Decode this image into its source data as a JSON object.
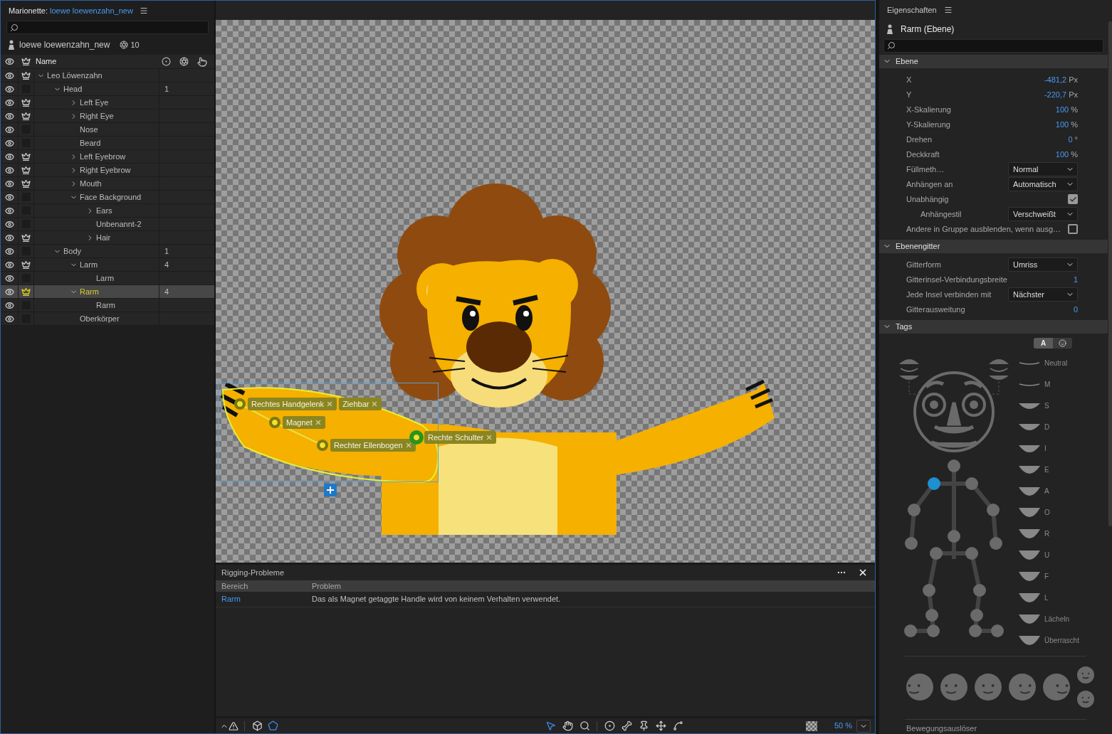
{
  "puppet": {
    "title_label": "Marionette:",
    "title_link": "loewe loewenzahn_new",
    "name": "loewe loewenzahn_new",
    "count": "10",
    "column_name": "Name",
    "layers": [
      {
        "name": "Leo Löwenzahn",
        "crown": true,
        "selected": false,
        "expanded": true,
        "children": [
          {
            "name": "Head",
            "crown": false,
            "selected": false,
            "expanded": true,
            "count": "1",
            "children": [
              {
                "name": "Left Eye",
                "crown": true,
                "selected": false,
                "expanded": false
              },
              {
                "name": "Right Eye",
                "crown": true,
                "selected": false,
                "expanded": false
              },
              {
                "name": "Nose",
                "crown": false,
                "selected": false
              },
              {
                "name": "Beard",
                "crown": false,
                "selected": false
              },
              {
                "name": "Left Eyebrow",
                "crown": true,
                "selected": false,
                "expanded": false
              },
              {
                "name": "Right Eyebrow",
                "crown": true,
                "selected": false,
                "expanded": false
              },
              {
                "name": "Mouth",
                "crown": true,
                "selected": false,
                "expanded": false
              },
              {
                "name": "Face Background",
                "crown": false,
                "selected": false,
                "expanded": true,
                "children": [
                  {
                    "name": "Ears",
                    "crown": false,
                    "selected": false,
                    "expanded": false
                  },
                  {
                    "name": "Unbenannt-2",
                    "crown": false,
                    "selected": false
                  },
                  {
                    "name": "Hair",
                    "crown": true,
                    "selected": false,
                    "expanded": false
                  }
                ]
              }
            ]
          },
          {
            "name": "Body",
            "crown": false,
            "selected": false,
            "expanded": true,
            "count": "1",
            "children": [
              {
                "name": "Larm",
                "crown": true,
                "selected": false,
                "expanded": true,
                "count": "4",
                "children": [
                  {
                    "name": "Larm",
                    "crown": false,
                    "selected": false
                  }
                ]
              },
              {
                "name": "Rarm",
                "crown": true,
                "selected": true,
                "expanded": true,
                "count": "4",
                "children": [
                  {
                    "name": "Rarm",
                    "crown": false,
                    "selected": false
                  }
                ]
              },
              {
                "name": "Oberkörper",
                "crown": false,
                "selected": false
              }
            ]
          }
        ]
      }
    ]
  },
  "canvas": {
    "handles": [
      {
        "tags": [
          "Rechtes Handgelenk",
          "Ziehbar"
        ],
        "selected": false
      },
      {
        "tags": [
          "Magnet"
        ],
        "selected": false
      },
      {
        "tags": [
          "Rechter Ellenbogen"
        ],
        "selected": false
      },
      {
        "tags": [
          "Rechte Schulter"
        ],
        "selected": true
      }
    ]
  },
  "problems": {
    "title": "Rigging-Probleme",
    "columns": [
      "Bereich",
      "Problem"
    ],
    "rows": [
      {
        "area": "Rarm",
        "problem": "Das als Magnet getaggte Handle wird von keinem Verhalten verwendet."
      }
    ]
  },
  "toolbar": {
    "left_tools": [
      {
        "kind": "mesh",
        "selected": false
      },
      {
        "kind": "polygon",
        "selected": true
      }
    ],
    "tools": [
      {
        "kind": "arrow",
        "selected": true
      },
      {
        "kind": "hand",
        "selected": false
      },
      {
        "kind": "zoom",
        "selected": false
      },
      {
        "kind": "handle",
        "selected": false
      },
      {
        "kind": "stick",
        "selected": false
      },
      {
        "kind": "pin",
        "selected": false
      },
      {
        "kind": "dragger",
        "selected": false
      },
      {
        "kind": "bend",
        "selected": false
      }
    ],
    "zoom": "50 %"
  },
  "properties": {
    "title": "Eigenschaften",
    "layer": "Rarm (Ebene)",
    "sections": [
      {
        "title": "Ebene",
        "expanded": true,
        "rows": [
          {
            "kind": "value",
            "label": "X",
            "value": "-481,2",
            "unit": "Px"
          },
          {
            "kind": "value",
            "label": "Y",
            "value": "-220,7",
            "unit": "Px"
          },
          {
            "kind": "value",
            "label": "X-Skalierung",
            "value": "100",
            "unit": "%"
          },
          {
            "kind": "value",
            "label": "Y-Skalierung",
            "value": "100",
            "unit": "%"
          },
          {
            "kind": "value",
            "label": "Drehen",
            "value": "0",
            "unit": "°"
          },
          {
            "kind": "value",
            "label": "Deckkraft",
            "value": "100",
            "unit": "%"
          },
          {
            "kind": "select",
            "label": "Füllmeth…",
            "value": "Normal"
          },
          {
            "kind": "select",
            "label": "Anhängen an",
            "value": "Automatisch"
          },
          {
            "kind": "checkbox",
            "label": "Unabhängig",
            "checked": true,
            "children": [
              {
                "kind": "select",
                "label": "Anhängestil",
                "value": "Verschweißt"
              }
            ]
          },
          {
            "kind": "checkbox",
            "label": "Andere in Gruppe ausblenden, wenn ausg…",
            "checked": false
          }
        ]
      },
      {
        "title": "Ebenengitter",
        "expanded": true,
        "rows": [
          {
            "kind": "select",
            "label": "Gitterform",
            "value": "Umriss"
          },
          {
            "kind": "value",
            "label": "Gitterinsel-Verbindungsbreite",
            "value": "1"
          },
          {
            "kind": "select",
            "label": "Jede Insel verbinden mit",
            "value": "Nächster"
          },
          {
            "kind": "value",
            "label": "Gitterausweitung",
            "value": "0"
          }
        ]
      }
    ],
    "tags": {
      "title": "Tags",
      "expanded": true,
      "modes": [
        {
          "kind": "text",
          "label": "A",
          "selected": true
        },
        {
          "kind": "face",
          "selected": false
        }
      ],
      "visemes": [
        "Neutral",
        "M",
        "S",
        "D",
        "I",
        "E",
        "A",
        "O",
        "R",
        "U",
        "F",
        "L",
        "Lächeln",
        "Überrascht"
      ],
      "footer": "Bewegungsauslöser"
    }
  }
}
